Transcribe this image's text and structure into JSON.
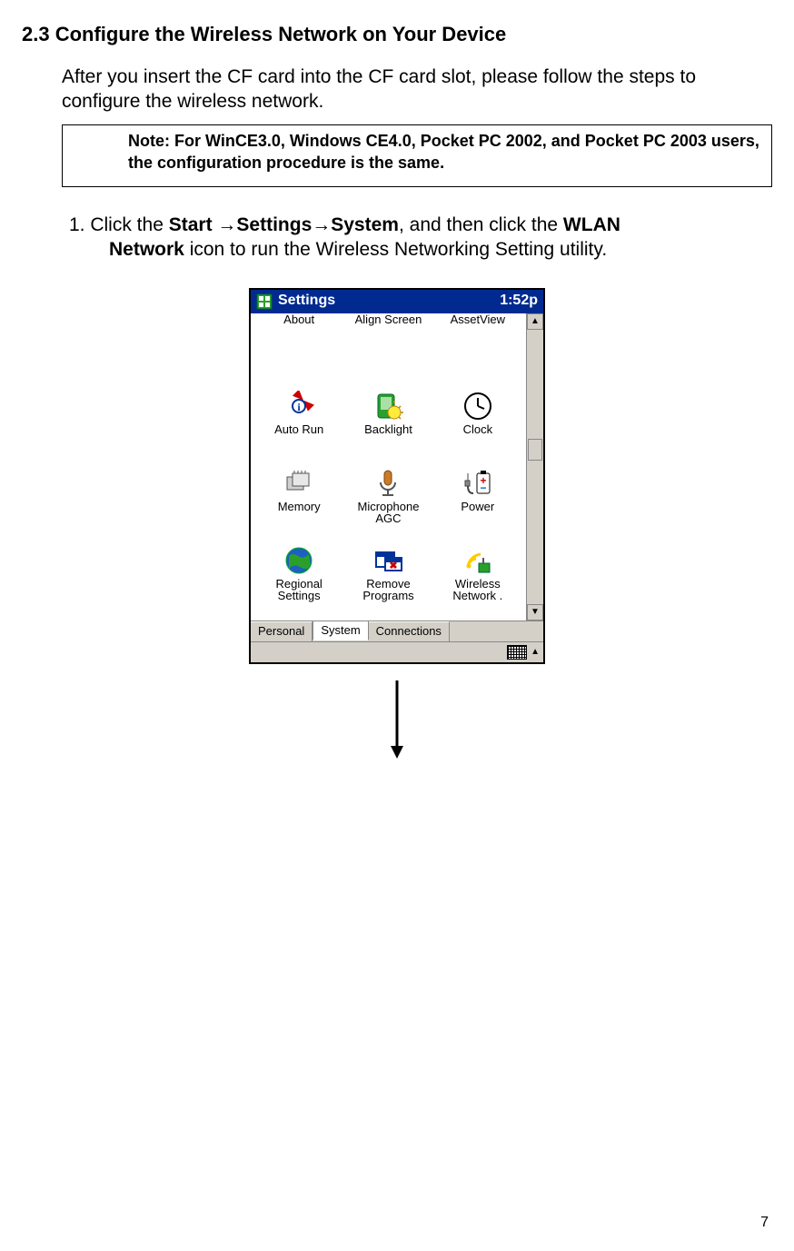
{
  "heading": "2.3 Configure the Wireless Network on Your Device",
  "intro": "After you insert the CF card into the CF card slot, please follow the steps to configure the wireless network.",
  "note": "Note: For WinCE3.0, Windows CE4.0, Pocket PC 2002, and Pocket PC 2003 users, the configuration procedure is the same.",
  "step1": {
    "prefix": "1. Click the ",
    "b1": "Start ",
    "arrow1": "→",
    "b2": "Settings",
    "arrow2": "→",
    "b3": "System",
    "mid": ", and then click the ",
    "b4": "WLAN ",
    "b5": "Network",
    "suffix": " icon to run the Wireless Networking Setting utility."
  },
  "page_number": "7",
  "screenshot": {
    "titlebar": {
      "title": "Settings",
      "time": "1:52p"
    },
    "icons": [
      {
        "label": "About",
        "toprow": true
      },
      {
        "label": "Align Screen",
        "toprow": true
      },
      {
        "label": "AssetView",
        "toprow": true
      },
      {
        "label": "Auto Run",
        "icon": "autorun"
      },
      {
        "label": "Backlight",
        "icon": "backlight"
      },
      {
        "label": "Clock",
        "icon": "clock"
      },
      {
        "label": "Memory",
        "icon": "memory"
      },
      {
        "label": "Microphone\nAGC",
        "icon": "mic"
      },
      {
        "label": "Power",
        "icon": "power"
      },
      {
        "label": "Regional\nSettings",
        "icon": "globe"
      },
      {
        "label": "Remove\nPrograms",
        "icon": "remove"
      },
      {
        "label": "Wireless\nNetwork .",
        "icon": "wifi"
      }
    ],
    "tabs": [
      {
        "label": "Personal",
        "active": false
      },
      {
        "label": "System",
        "active": true
      },
      {
        "label": "Connections",
        "active": false
      }
    ]
  }
}
